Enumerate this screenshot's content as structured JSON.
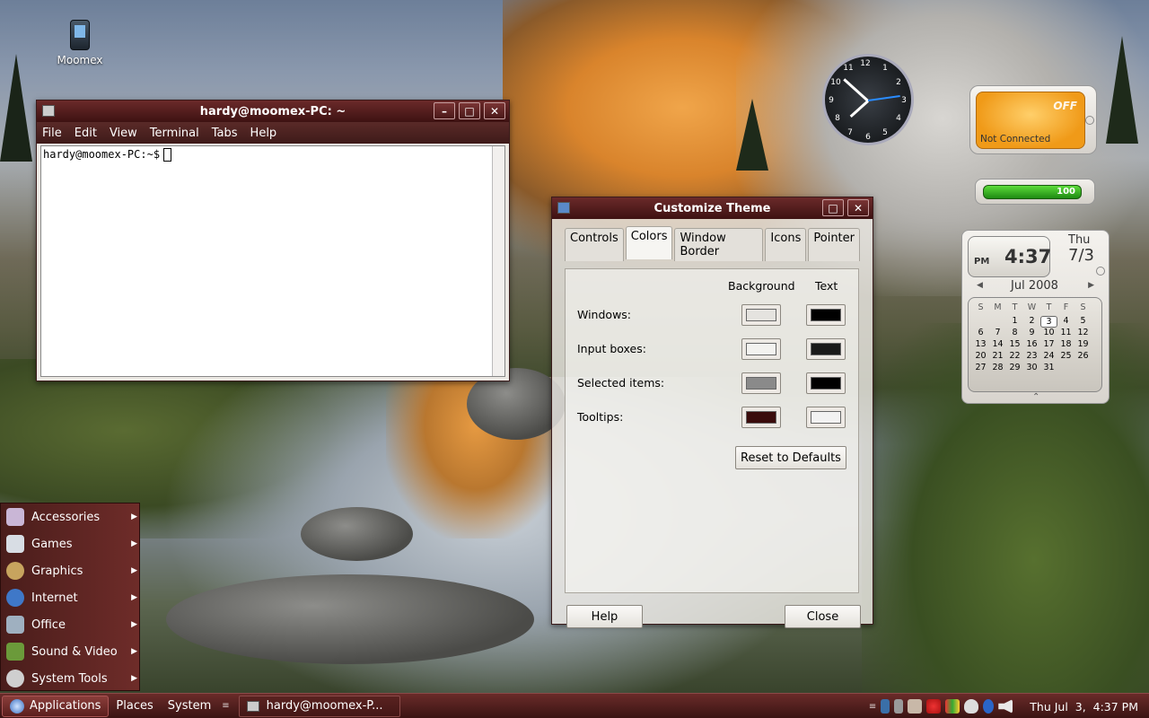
{
  "desktop": {
    "icons": [
      {
        "label": "Moomex",
        "icon": "phone-icon"
      }
    ]
  },
  "terminal": {
    "title": "hardy@moomex-PC: ~",
    "menu": [
      "File",
      "Edit",
      "View",
      "Terminal",
      "Tabs",
      "Help"
    ],
    "prompt": "hardy@moomex-PC:~$"
  },
  "theme_dialog": {
    "title": "Customize Theme",
    "tabs": [
      "Controls",
      "Colors",
      "Window Border",
      "Icons",
      "Pointer"
    ],
    "active_tab": "Colors",
    "col_background": "Background",
    "col_text": "Text",
    "rows": [
      {
        "label": "Windows:",
        "bg": "#e5e3df",
        "fg": "#000000"
      },
      {
        "label": "Input boxes:",
        "bg": "#f3f2ef",
        "fg": "#1a1a1a"
      },
      {
        "label": "Selected items:",
        "bg": "#8a8a8a",
        "fg": "#000000"
      },
      {
        "label": "Tooltips:",
        "bg": "#3a0c0c",
        "fg": "#f2f2f2"
      }
    ],
    "reset_label": "Reset to Defaults",
    "help_label": "Help",
    "close_label": "Close"
  },
  "clock_gadget": {
    "numbers": [
      "12",
      "1",
      "2",
      "3",
      "4",
      "5",
      "6",
      "7",
      "8",
      "9",
      "10",
      "11"
    ]
  },
  "network_gadget": {
    "state": "OFF",
    "status": "Not Connected"
  },
  "battery_gadget": {
    "level": "100"
  },
  "calendar_gadget": {
    "ampm": "PM",
    "time": "4:37",
    "weekday": "Thu",
    "date": "7/3",
    "month": "Jul 2008",
    "days_header": [
      "S",
      "M",
      "T",
      "W",
      "T",
      "F",
      "S"
    ],
    "weeks": [
      [
        "",
        "",
        "1",
        "2",
        "3",
        "4",
        "5"
      ],
      [
        "6",
        "7",
        "8",
        "9",
        "10",
        "11",
        "12"
      ],
      [
        "13",
        "14",
        "15",
        "16",
        "17",
        "18",
        "19"
      ],
      [
        "20",
        "21",
        "22",
        "23",
        "24",
        "25",
        "26"
      ],
      [
        "27",
        "28",
        "29",
        "30",
        "31",
        "",
        ""
      ]
    ],
    "today": "3"
  },
  "app_menu": {
    "items": [
      {
        "label": "Accessories",
        "icon": "accessories-icon",
        "color": "#c9b6d6"
      },
      {
        "label": "Games",
        "icon": "games-icon",
        "color": "#d8dde4"
      },
      {
        "label": "Graphics",
        "icon": "graphics-icon",
        "color": "#c7a45e"
      },
      {
        "label": "Internet",
        "icon": "globe-icon",
        "color": "#3f78c8"
      },
      {
        "label": "Office",
        "icon": "office-icon",
        "color": "#9fb0c0"
      },
      {
        "label": "Sound & Video",
        "icon": "sound-video-icon",
        "color": "#6b9a3a"
      },
      {
        "label": "System Tools",
        "icon": "gear-icon",
        "color": "#cfcfcf"
      }
    ]
  },
  "panel": {
    "applications": "Applications",
    "places": "Places",
    "system": "System",
    "task": "hardy@moomex-P...",
    "datetime": "Thu Jul  3,  4:37 PM"
  }
}
